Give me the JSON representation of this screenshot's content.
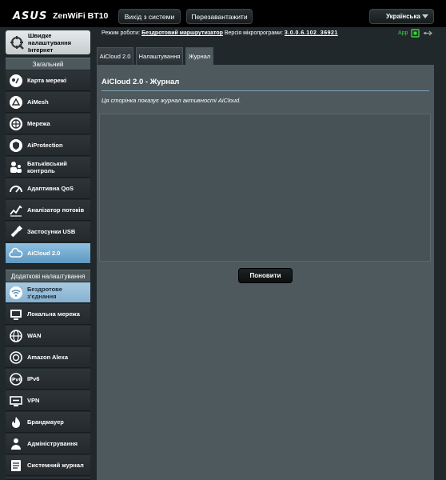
{
  "header": {
    "logo": "ASUS",
    "model": "ZenWiFi BT10",
    "logout_label": "Вихід з системи",
    "reboot_label": "Перезавантажити",
    "language": "Українська"
  },
  "quick_setup": {
    "label": "Швидке налаштування Інтернет"
  },
  "sidebar": {
    "general_header": "Загальний",
    "general_items": [
      {
        "label": "Карта мережі",
        "icon": "network-map-icon"
      },
      {
        "label": "AiMesh",
        "icon": "aimesh-icon"
      },
      {
        "label": "Мережа",
        "icon": "guest-network-icon"
      },
      {
        "label": "AiProtection",
        "icon": "aiprotection-icon"
      },
      {
        "label": "Батьківський контроль",
        "icon": "parental-control-icon"
      },
      {
        "label": "Адаптивна QoS",
        "icon": "qos-icon"
      },
      {
        "label": "Аналізатор потоків",
        "icon": "traffic-analyzer-icon"
      },
      {
        "label": "Застосунки USB",
        "icon": "usb-icon"
      },
      {
        "label": "AiCloud 2.0",
        "icon": "cloud-icon",
        "active": true
      }
    ],
    "advanced_header": "Додаткові налаштування",
    "advanced_items": [
      {
        "label": "Бездротове з'єднання",
        "icon": "wireless-icon",
        "active": true
      },
      {
        "label": "Локальна мережа",
        "icon": "lan-icon"
      },
      {
        "label": "WAN",
        "icon": "wan-icon"
      },
      {
        "label": "Amazon Alexa",
        "icon": "alexa-icon"
      },
      {
        "label": "IPv6",
        "icon": "ipv6-icon"
      },
      {
        "label": "VPN",
        "icon": "vpn-icon"
      },
      {
        "label": "Брандмауер",
        "icon": "firewall-icon"
      },
      {
        "label": "Адміністрування",
        "icon": "administration-icon"
      },
      {
        "label": "Системний журнал",
        "icon": "system-log-icon"
      }
    ]
  },
  "status": {
    "mode_label": "Режим роботи:",
    "mode_value": "Бездротовий маршрутизатор",
    "firmware_label": "Версія мікропрограми:",
    "firmware_value": "3.0.0.6.102_36921",
    "app_label": "App"
  },
  "tabs": [
    {
      "label": "AiCloud 2.0"
    },
    {
      "label": "Налаштування"
    },
    {
      "label": "Журнал",
      "selected": true
    }
  ],
  "main": {
    "title": "AiCloud 2.0 - Журнал",
    "description": "Ця сторінка показує журнал активності AiCloud.",
    "log_content": "",
    "refresh_label": "Поновити"
  },
  "colors": {
    "accent": "#5f98c0",
    "panel": "#4d595d",
    "background": "#21282b",
    "status_green": "#3ed13e"
  }
}
